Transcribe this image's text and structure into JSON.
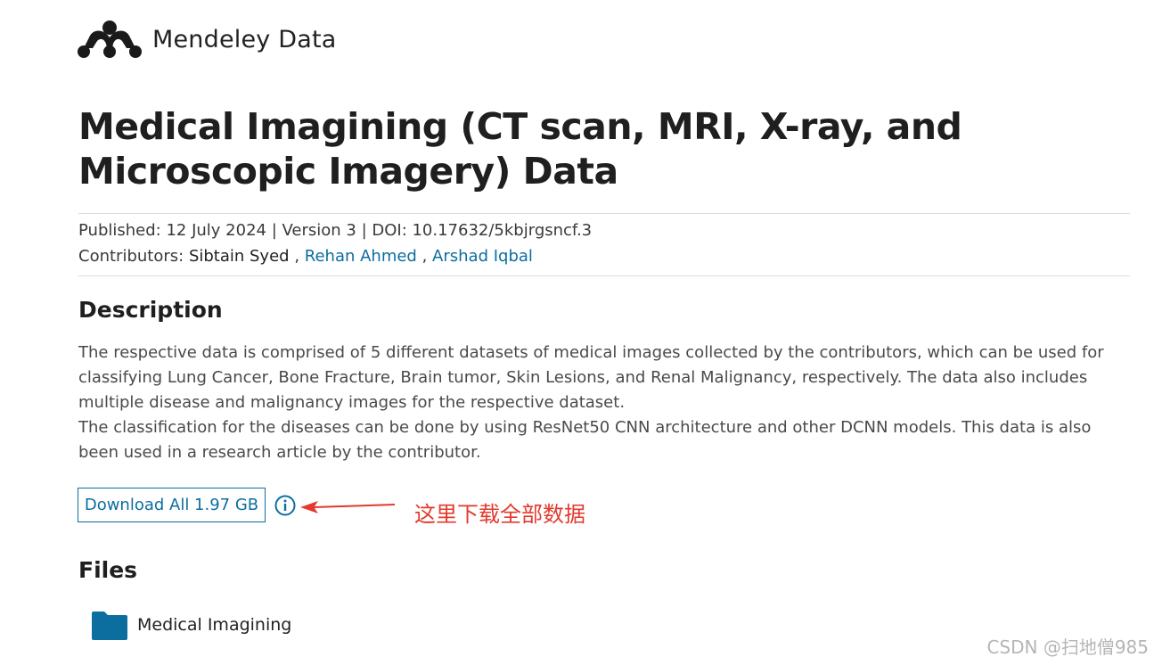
{
  "header": {
    "brand_name": "Mendeley Data",
    "logo_icon": "mendeley-logo-icon"
  },
  "dataset": {
    "title": "Medical Imagining (CT scan, MRI, X-ray, and Microscopic Imagery) Data",
    "published_line": "Published: 12 July 2024 | Version 3 | DOI: 10.17632/5kbjrgsncf.3",
    "contributors_label": "Contributors:",
    "contributors": [
      "Sibtain Syed",
      "Rehan Ahmed",
      "Arshad Iqbal"
    ],
    "contributor_separator": " , "
  },
  "description": {
    "heading": "Description",
    "paragraphs": [
      "The respective data is comprised of 5 different datasets of medical images collected by the contributors, which can be used for classifying Lung Cancer, Bone Fracture, Brain tumor, Skin Lesions, and Renal Malignancy, respectively. The data also includes multiple disease and malignancy images for the respective dataset.",
      "The classification for the diseases can be done by using ResNet50 CNN architecture and other DCNN models. This data is also been used in a research article by the contributor."
    ]
  },
  "download": {
    "label": "Download All 1.97 GB",
    "info_icon": "info-icon"
  },
  "annotation": {
    "text": "这里下载全部数据",
    "color": "#e23a2e"
  },
  "files": {
    "heading": "Files",
    "items": [
      {
        "name": "Medical Imagining",
        "icon": "folder-icon"
      }
    ]
  },
  "watermark": "CSDN @扫地僧985",
  "colors": {
    "link": "#0c6e9e",
    "folder": "#0c6e9e",
    "text": "#2e2e2e",
    "rule": "#dcdcdc"
  }
}
